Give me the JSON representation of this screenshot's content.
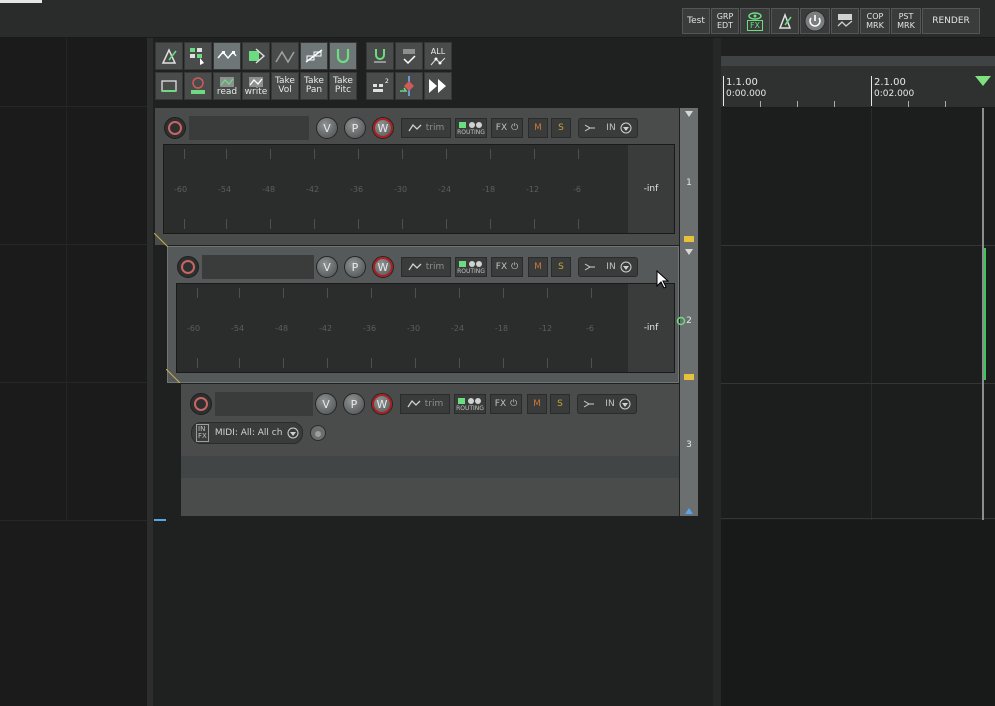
{
  "toolbar_top": {
    "test": "Test",
    "grp_edt": "GRP\nEDT",
    "fx": "FX",
    "cop_mrk": "COP\nMRK",
    "pst_mrk": "PST\nMRK",
    "render": "RENDER"
  },
  "main_toolbar": {
    "all": "ALL",
    "read": "read",
    "write": "write",
    "take_vol": "Take\nVol",
    "take_pan": "Take\nPan",
    "take_pitc": "Take\nPitc"
  },
  "track_controls": {
    "v": "V",
    "p": "P",
    "w": "W",
    "trim": "trim",
    "routing": "ROUTING",
    "fx": "FX",
    "m": "M",
    "s": "S",
    "in": "IN"
  },
  "meter_labels": [
    "-60",
    "-54",
    "-48",
    "-42",
    "-36",
    "-30",
    "-24",
    "-18",
    "-12",
    "-6"
  ],
  "meter_inf": "-inf",
  "tracks": [
    {
      "number": "1"
    },
    {
      "number": "2"
    },
    {
      "number": "3"
    }
  ],
  "midi_input": {
    "in_fx": "IN\nFX",
    "label": "MIDI: All: All ch"
  },
  "ruler": {
    "mark1_bar": "1.1.00",
    "mark1_time": "0:00.000",
    "mark2_bar": "2.1.00",
    "mark2_time": "0:02.000"
  },
  "colors": {
    "accent_green": "#6bdc7f",
    "record_red": "#b01e1e",
    "track_bg": "#4a4c4c"
  }
}
